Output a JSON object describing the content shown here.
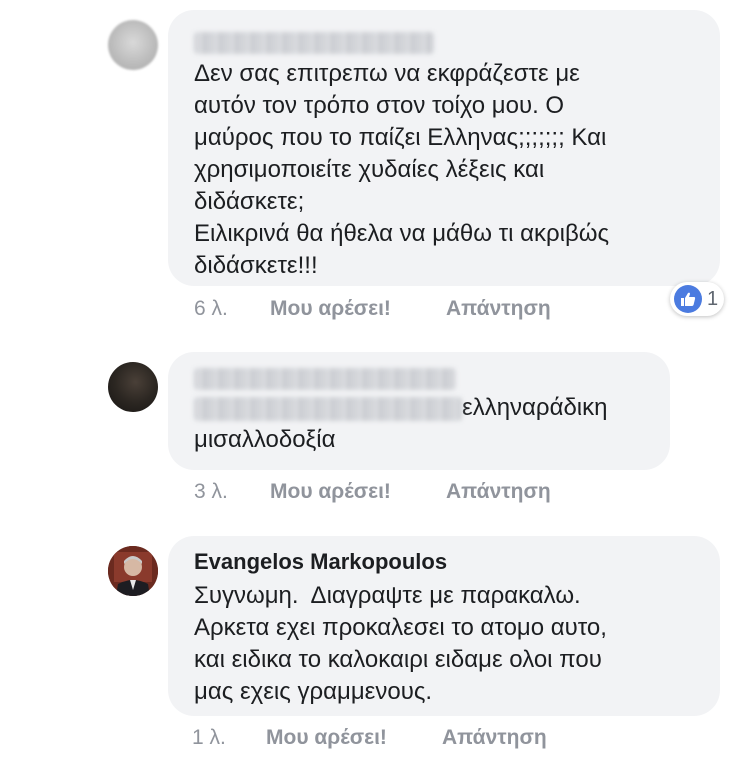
{
  "comments": [
    {
      "author_hidden": true,
      "text": "Δεν σας επιτρεπω να εκφράζεστε με\nαυτόν τον τρόπο στον τοίχο μου. Ο\nμαύρος που το παίζει Ελληνας;;;;;;; Και\nχρησιμοποιείτε χυδαίες λέξεις και\nδιδάσκετε;\nΕιλικρινά θα ήθελα να μάθω τι ακριβώς\nδιδάσκετε!!!",
      "time": "6 λ.",
      "like_label": "Μου αρέσει!",
      "reply_label": "Απάντηση",
      "reaction_count": "1",
      "reaction_icon": "like-icon"
    },
    {
      "author_hidden": true,
      "text_suffix": "ελληναράδικη",
      "text_line2": "μισαλλοδοξία",
      "time": "3 λ.",
      "like_label": "Μου αρέσει!",
      "reply_label": "Απάντηση"
    },
    {
      "author": "Evangelos Markopoulos",
      "text": "Συγνωμη.  Διαγραψτε με παρακαλω.\nΑρκετα εχει προκαλεσει το ατομο αυτο,\nκαι ειδικα το καλοκαιρι ειδαμε ολοι που\nμας εχεις γραμμενους.",
      "time": "1 λ.",
      "like_label": "Μου αρέσει!",
      "reply_label": "Απάντηση"
    }
  ],
  "colors": {
    "bubble": "#f2f3f5",
    "meta_text": "#90949c",
    "like_badge": "#4b7be0"
  }
}
